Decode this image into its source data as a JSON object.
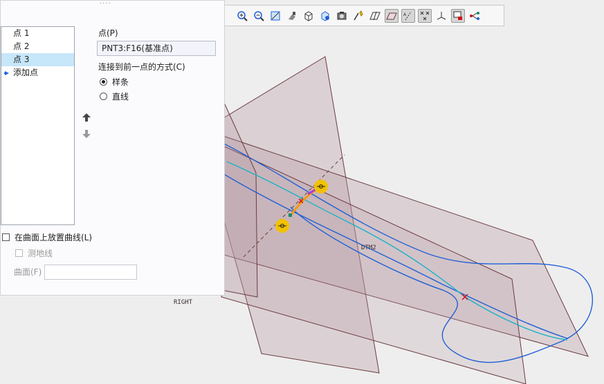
{
  "toolbar": {
    "icons": [
      "zoom-in-icon",
      "zoom-out-icon",
      "refit-icon",
      "repaint-icon",
      "view-manager-icon",
      "saved-orientations-icon",
      "display-style-icon",
      "annotation-display-icon",
      "plane-display-icon",
      "axis-display-icon",
      "point-display-icon",
      "csys-display-icon",
      "spin-center-icon",
      "model-tree-filter-icon"
    ]
  },
  "panel": {
    "points": [
      "点 1",
      "点 2",
      "点 3"
    ],
    "selected_index": 2,
    "add_point": "添加点",
    "point_label": "点(P)",
    "point_value": "PNT3:F16(基准点)",
    "connect_label": "连接到前一点的方式(C)",
    "options": [
      {
        "label": "样条",
        "checked": true
      },
      {
        "label": "直线",
        "checked": false
      }
    ],
    "place_on_surface": "在曲面上放置曲线(L)",
    "geodesic": "测地线",
    "surface_label": "曲面(F)"
  },
  "viewport": {
    "datum_labels": {
      "dtm2": "DTM2",
      "right": "RIGHT"
    },
    "colors": {
      "plane_fill": "#b89aa2",
      "plane_edge": "#6b3a40",
      "curve": "#1f5fd6",
      "spline": "#19b3c8",
      "handle": "#f2c200",
      "point_marker": "#d0101a"
    }
  }
}
